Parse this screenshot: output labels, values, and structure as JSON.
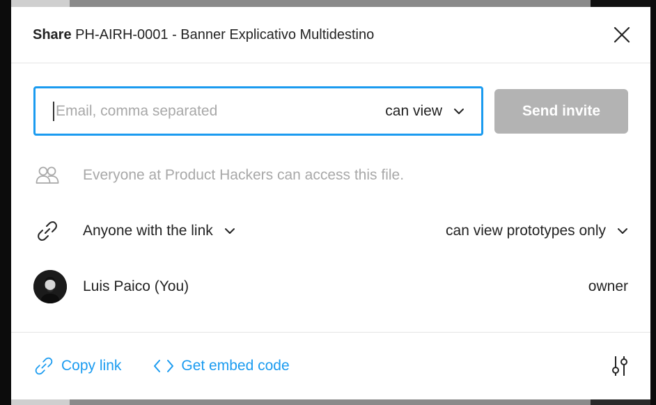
{
  "dialog": {
    "title_prefix": "Share",
    "title_file": "PH-AIRH-0001 - Banner Explicativo Multidestino",
    "close_icon": "close-icon"
  },
  "invite": {
    "email_placeholder": "Email, comma separated",
    "email_value": "",
    "permission": "can view",
    "send_label": "Send invite"
  },
  "team_access": {
    "icon": "people-icon",
    "text": "Everyone at Product Hackers can access this file."
  },
  "link_access": {
    "icon": "link-icon",
    "scope": "Anyone with the link",
    "permission": "can view prototypes only"
  },
  "members": [
    {
      "name": "Luis Paico (You)",
      "role": "owner",
      "avatar": "avatar-photo"
    }
  ],
  "footer": {
    "copy_link": "Copy link",
    "embed_code": "Get embed code",
    "settings_icon": "sliders-icon"
  },
  "colors": {
    "accent": "#1a9bf0",
    "send_disabled": "#b3b3b3",
    "muted_text": "#a8a8a8"
  }
}
